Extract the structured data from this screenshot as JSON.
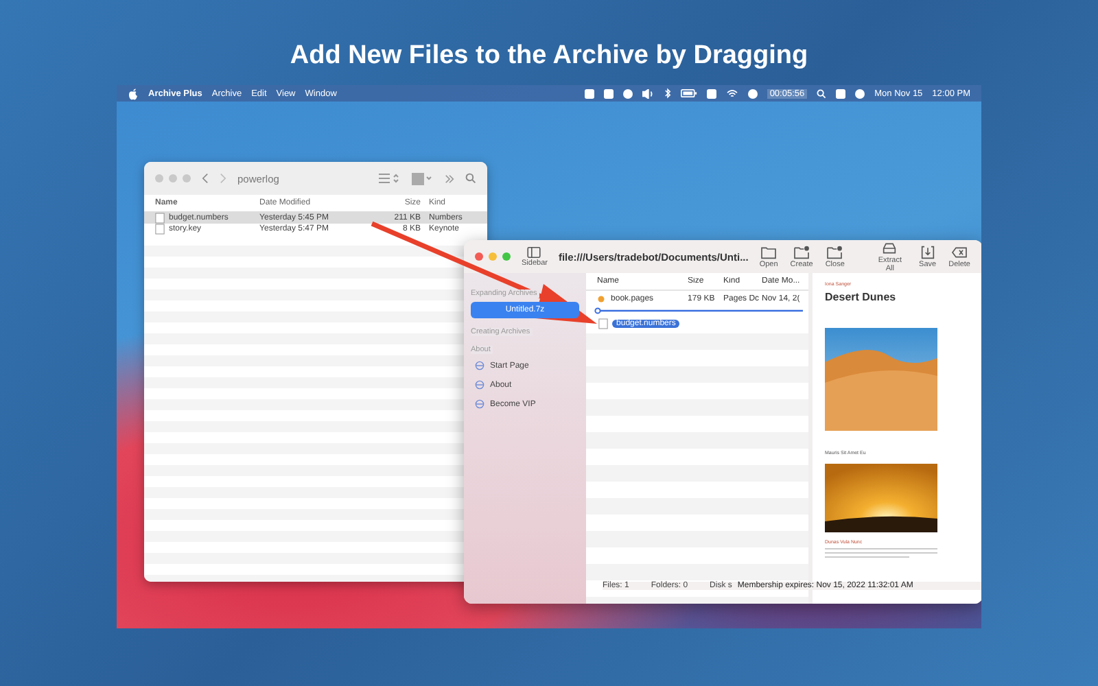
{
  "headline": "Add New Files to the Archive by Dragging",
  "menubar": {
    "app_name": "Archive Plus",
    "menus": [
      "Archive",
      "Edit",
      "View",
      "Window"
    ],
    "timer": "00:05:56",
    "date": "Mon Nov 15",
    "time": "12:00 PM"
  },
  "finder": {
    "folder": "powerlog",
    "columns": [
      "Name",
      "Date Modified",
      "Size",
      "Kind"
    ],
    "rows": [
      {
        "name": "budget.numbers",
        "date": "Yesterday 5:45 PM",
        "size": "211 KB",
        "kind": "Numbers",
        "selected": true
      },
      {
        "name": "story.key",
        "date": "Yesterday 5:47 PM",
        "size": "8 KB",
        "kind": "Keynote",
        "selected": false
      }
    ]
  },
  "archive_window": {
    "sidebar_button": "Sidebar",
    "path": "file:///Users/tradebot/Documents/Unti...",
    "tools": [
      "Open",
      "Create",
      "Close",
      "Extract All",
      "Save",
      "Delete"
    ],
    "sidebar": [
      {
        "title": "Expanding Archives",
        "items": [
          {
            "label": "Untitled.7z",
            "kind": "archive",
            "selected": true
          }
        ]
      },
      {
        "title": "Creating Archives"
      },
      {
        "title": "About",
        "items": [
          {
            "label": "Start Page",
            "kind": "link",
            "selected": false
          },
          {
            "label": "About",
            "kind": "link",
            "selected": false
          },
          {
            "label": "Become VIP",
            "kind": "link",
            "selected": false
          }
        ]
      }
    ],
    "columns": [
      "Name",
      "Size",
      "Kind",
      "Date Mo..."
    ],
    "rows": [
      {
        "name": "book.pages",
        "size": "179 KB",
        "kind": "Pages Dc",
        "date": "Nov 14, 2("
      }
    ],
    "dragged_file": "budget.numbers",
    "preview": {
      "kicker": "Iona Sanger",
      "title": "Desert Dunes",
      "caption": "Mauris Sit Amet Eu",
      "section": "Dunas Vula Nunc"
    },
    "status": {
      "files": "Files: 1",
      "folders": "Folders: 0",
      "disk": "Disk s",
      "membership": "Membership expires: Nov 15, 2022 11:32:01 AM"
    }
  }
}
